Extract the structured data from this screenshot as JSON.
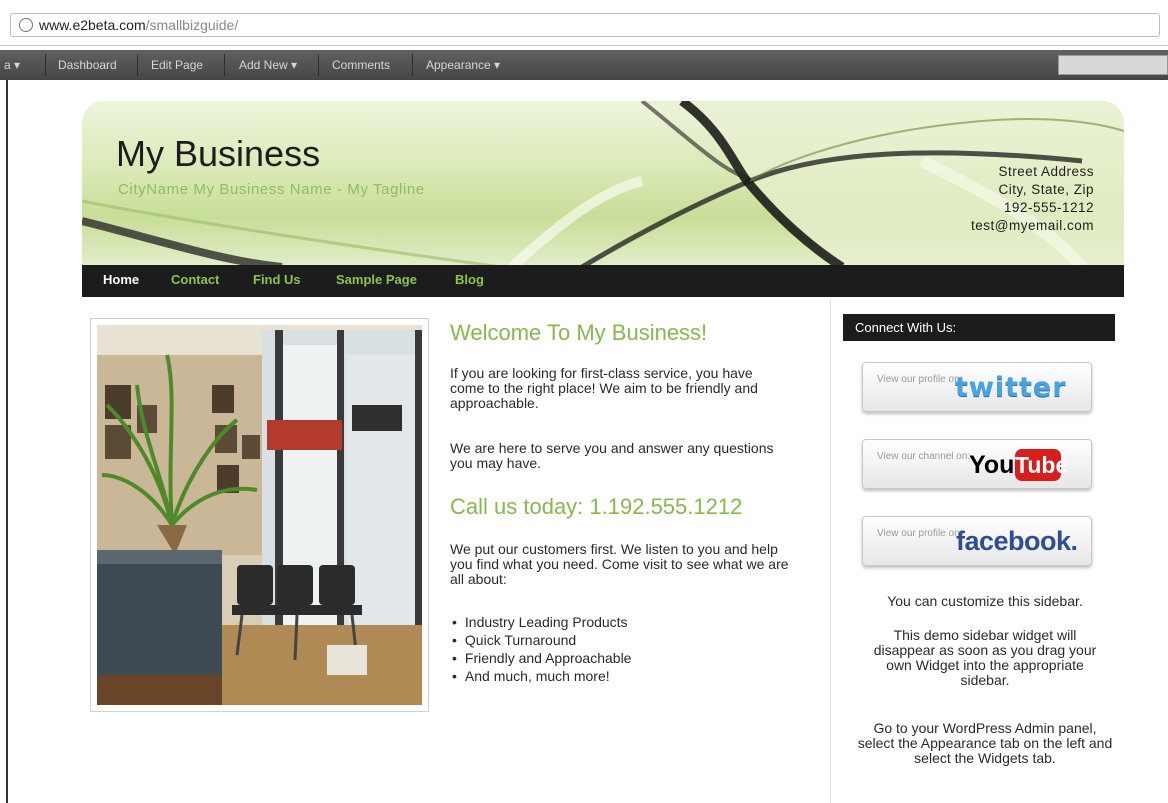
{
  "browser": {
    "url_domain": "www.e2beta.com",
    "url_path": "/smallbizguide/"
  },
  "adminbar": {
    "items": [
      {
        "label": "a",
        "dropdown": true
      },
      {
        "label": "Dashboard",
        "dropdown": false
      },
      {
        "label": "Edit Page",
        "dropdown": false
      },
      {
        "label": "Add New",
        "dropdown": true
      },
      {
        "label": "Comments",
        "dropdown": false
      },
      {
        "label": "Appearance",
        "dropdown": true
      }
    ]
  },
  "header": {
    "title": "My Business",
    "tagline": "CityName My Business Name - My Tagline",
    "address": [
      "Street Address",
      "City, State, Zip",
      "192-555-1212",
      "test@myemail.com"
    ]
  },
  "nav": [
    "Home",
    "Contact",
    "Find Us",
    "Sample Page",
    "Blog"
  ],
  "main": {
    "heading": "Welcome To My Business!",
    "paragraphs": [
      "If you are looking for first-class service, you have come to the right place! We aim to be friendly and approachable.",
      "We are here to serve you and answer any questions you may have.",
      "We put our customers first. We listen to you and help you find what you need. Come visit to see what we are all about:"
    ],
    "call": "Call us today: 1.192.555.1212",
    "bullets": [
      "Industry Leading Products",
      "Quick Turnaround",
      "Friendly and Approachable",
      "And much, much more!"
    ]
  },
  "sidebar": {
    "heading": "Connect With Us:",
    "social": [
      {
        "small": "View our profile on:",
        "brand": "twitter"
      },
      {
        "small": "View our channel on:",
        "brand_a": "You",
        "brand_b": "Tube"
      },
      {
        "small": "View our profile on:",
        "brand": "facebook."
      }
    ],
    "texts": [
      "You can customize this sidebar.",
      "This demo sidebar widget will disappear as soon as you drag your own Widget into the appropriate sidebar.",
      "Go to your WordPress Admin panel, select the Appearance tab on the left and select the Widgets tab."
    ]
  },
  "colors": {
    "accent_green": "#86b84e",
    "nav_bg": "#1c1c1c",
    "admin_bg": "#4f4f4f"
  }
}
